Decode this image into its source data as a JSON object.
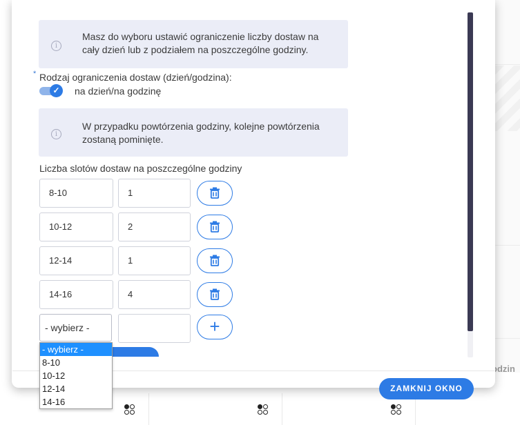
{
  "background": {
    "right_label": "odzin"
  },
  "modal": {
    "info_boxes": [
      {
        "text": "Masz do wyboru ustawić ograniczenie liczby dostaw na cały dzień lub z podziałem na poszczególne godziny."
      },
      {
        "text": "W przypadku powtórzenia godziny, kolejne powtórzenia zostaną pominięte."
      }
    ],
    "limit_type": {
      "required_mark": "*",
      "label": "Rodzaj ograniczenia dostaw (dzień/godzina):",
      "toggle_text": "na dzień/na godzinę"
    },
    "slots_label": "Liczba slotów dostaw na poszczególne godziny",
    "slots": [
      {
        "hour": "8-10",
        "count": "1"
      },
      {
        "hour": "10-12",
        "count": "2"
      },
      {
        "hour": "12-14",
        "count": "1"
      },
      {
        "hour": "14-16",
        "count": "4"
      }
    ],
    "new_slot": {
      "hour_selected": "- wybierz -",
      "count": "",
      "add_symbol": "+"
    },
    "dropdown_options": [
      "- wybierz -",
      "8-10",
      "10-12",
      "12-14",
      "14-16"
    ],
    "close_button": "ZAMKNIJ OKNO"
  },
  "colors": {
    "accent": "#2d7be5",
    "info_bg": "#ebedf7",
    "scrollbar": "#3b3a54",
    "dropdown_selected": "#1e90ff"
  },
  "icons": {
    "info": "info-icon",
    "delete": "trash-icon",
    "add": "plus-icon",
    "toggle_check": "check-icon",
    "grid": "dots-grid-icon"
  }
}
